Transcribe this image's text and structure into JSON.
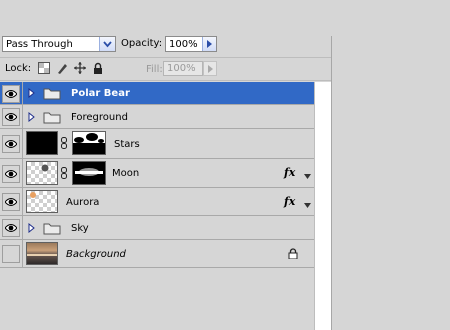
{
  "blend_mode": {
    "value": "Pass Through"
  },
  "opacity": {
    "label": "Opacity:",
    "value": "100%"
  },
  "lock": {
    "label": "Lock:"
  },
  "fill": {
    "label": "Fill:",
    "value": "100%"
  },
  "fx_label": "fx",
  "layers": [
    {
      "name": "Polar Bear",
      "type": "group",
      "selected": true,
      "visible": true
    },
    {
      "name": "Foreground",
      "type": "group",
      "selected": false,
      "visible": true
    },
    {
      "name": "Stars",
      "type": "masked-layer",
      "visible": true
    },
    {
      "name": "Moon",
      "type": "masked-layer",
      "visible": true,
      "has_fx": true
    },
    {
      "name": "Aurora",
      "type": "layer",
      "visible": true,
      "has_fx": true
    },
    {
      "name": "Sky",
      "type": "group",
      "visible": true
    },
    {
      "name": "Background",
      "type": "background",
      "visible": false,
      "locked": true
    }
  ],
  "colors": {
    "selection": "#3169c6",
    "panel": "#d6d6d6"
  }
}
